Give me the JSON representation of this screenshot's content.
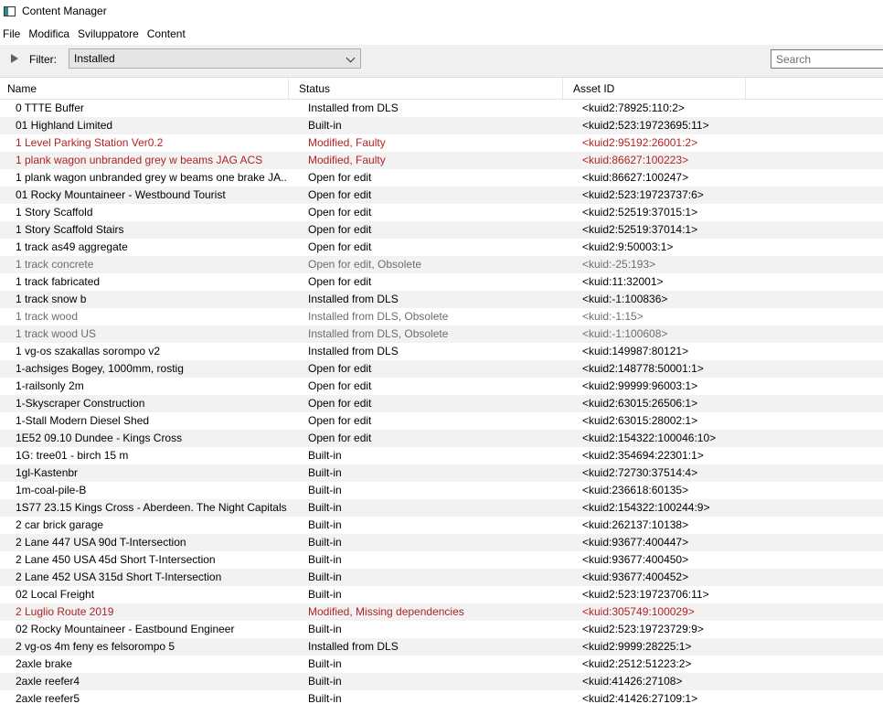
{
  "window": {
    "title": "Content Manager"
  },
  "menu": [
    "File",
    "Modifica",
    "Sviluppatore",
    "Content"
  ],
  "toolbar": {
    "filter_label": "Filter:",
    "filter_value": "Installed",
    "search_placeholder": "Search"
  },
  "columns": {
    "name": "Name",
    "status": "Status",
    "asset_id": "Asset ID"
  },
  "colors": {
    "faulty": "#b22222",
    "obsolete": "#6d6d6d",
    "alt_row": "#f2f2f2"
  },
  "rows": [
    {
      "name": "0 TTTE Buffer",
      "status": "Installed from DLS",
      "asset_id": "<kuid2:78925:110:2>",
      "state": "normal"
    },
    {
      "name": "01 Highland Limited",
      "status": "Built-in",
      "asset_id": "<kuid2:523:19723695:11>",
      "state": "normal"
    },
    {
      "name": "1 Level Parking Station Ver0.2",
      "status": "Modified, Faulty",
      "asset_id": "<kuid2:95192:26001:2>",
      "state": "faulty"
    },
    {
      "name": "1 plank wagon unbranded grey w beams JAG ACS",
      "status": "Modified, Faulty",
      "asset_id": "<kuid:86627:100223>",
      "state": "faulty"
    },
    {
      "name": "1 plank wagon unbranded grey w beams one brake JA...",
      "status": "Open for edit",
      "asset_id": "<kuid:86627:100247>",
      "state": "normal"
    },
    {
      "name": "01 Rocky Mountaineer - Westbound Tourist",
      "status": "Open for edit",
      "asset_id": "<kuid2:523:19723737:6>",
      "state": "normal"
    },
    {
      "name": "1 Story Scaffold",
      "status": "Open for edit",
      "asset_id": "<kuid2:52519:37015:1>",
      "state": "normal"
    },
    {
      "name": "1 Story Scaffold Stairs",
      "status": "Open for edit",
      "asset_id": "<kuid2:52519:37014:1>",
      "state": "normal"
    },
    {
      "name": "1 track as49 aggregate",
      "status": "Open for edit",
      "asset_id": "<kuid2:9:50003:1>",
      "state": "normal"
    },
    {
      "name": "1 track concrete",
      "status": "Open for edit, Obsolete",
      "asset_id": "<kuid:-25:193>",
      "state": "obsolete"
    },
    {
      "name": "1 track fabricated",
      "status": "Open for edit",
      "asset_id": "<kuid:11:32001>",
      "state": "normal"
    },
    {
      "name": "1 track snow b",
      "status": "Installed from DLS",
      "asset_id": "<kuid:-1:100836>",
      "state": "normal"
    },
    {
      "name": "1 track wood",
      "status": "Installed from DLS, Obsolete",
      "asset_id": "<kuid:-1:15>",
      "state": "obsolete"
    },
    {
      "name": "1 track wood US",
      "status": "Installed from DLS, Obsolete",
      "asset_id": "<kuid:-1:100608>",
      "state": "obsolete"
    },
    {
      "name": "1 vg-os szakallas sorompo v2",
      "status": "Installed from DLS",
      "asset_id": "<kuid:149987:80121>",
      "state": "normal"
    },
    {
      "name": "1-achsiges Bogey, 1000mm, rostig",
      "status": "Open for edit",
      "asset_id": "<kuid2:148778:50001:1>",
      "state": "normal"
    },
    {
      "name": "1-railsonly 2m",
      "status": "Open for edit",
      "asset_id": "<kuid2:99999:96003:1>",
      "state": "normal"
    },
    {
      "name": "1-Skyscraper Construction",
      "status": "Open for edit",
      "asset_id": "<kuid2:63015:26506:1>",
      "state": "normal"
    },
    {
      "name": "1-Stall Modern Diesel Shed",
      "status": "Open for edit",
      "asset_id": "<kuid2:63015:28002:1>",
      "state": "normal"
    },
    {
      "name": "1E52 09.10 Dundee - Kings Cross",
      "status": "Open for edit",
      "asset_id": "<kuid2:154322:100046:10>",
      "state": "normal"
    },
    {
      "name": "1G: tree01 - birch 15 m",
      "status": "Built-in",
      "asset_id": "<kuid2:354694:22301:1>",
      "state": "normal"
    },
    {
      "name": "1gl-Kastenbr",
      "status": "Built-in",
      "asset_id": "<kuid2:72730:37514:4>",
      "state": "normal"
    },
    {
      "name": "1m-coal-pile-B",
      "status": "Built-in",
      "asset_id": "<kuid:236618:60135>",
      "state": "normal"
    },
    {
      "name": "1S77 23.15 Kings Cross - Aberdeen. The Night Capitals",
      "status": "Built-in",
      "asset_id": "<kuid2:154322:100244:9>",
      "state": "normal"
    },
    {
      "name": "2 car brick garage",
      "status": "Built-in",
      "asset_id": "<kuid:262137:10138>",
      "state": "normal"
    },
    {
      "name": "2 Lane 447 USA 90d T-Intersection",
      "status": "Built-in",
      "asset_id": "<kuid:93677:400447>",
      "state": "normal"
    },
    {
      "name": "2 Lane 450 USA 45d Short T-Intersection",
      "status": "Built-in",
      "asset_id": "<kuid:93677:400450>",
      "state": "normal"
    },
    {
      "name": "2 Lane 452 USA 315d Short T-Intersection",
      "status": "Built-in",
      "asset_id": "<kuid:93677:400452>",
      "state": "normal"
    },
    {
      "name": "02 Local Freight",
      "status": "Built-in",
      "asset_id": "<kuid2:523:19723706:11>",
      "state": "normal"
    },
    {
      "name": "2 Luglio Route 2019",
      "status": "Modified, Missing dependencies",
      "asset_id": "<kuid:305749:100029>",
      "state": "faulty"
    },
    {
      "name": "02 Rocky Mountaineer - Eastbound Engineer",
      "status": "Built-in",
      "asset_id": "<kuid2:523:19723729:9>",
      "state": "normal"
    },
    {
      "name": "2 vg-os 4m feny es felsorompo 5",
      "status": "Installed from DLS",
      "asset_id": "<kuid2:9999:28225:1>",
      "state": "normal"
    },
    {
      "name": "2axle brake",
      "status": "Built-in",
      "asset_id": "<kuid2:2512:51223:2>",
      "state": "normal"
    },
    {
      "name": "2axle reefer4",
      "status": "Built-in",
      "asset_id": "<kuid:41426:27108>",
      "state": "normal"
    },
    {
      "name": "2axle reefer5",
      "status": "Built-in",
      "asset_id": "<kuid2:41426:27109:1>",
      "state": "normal"
    }
  ]
}
